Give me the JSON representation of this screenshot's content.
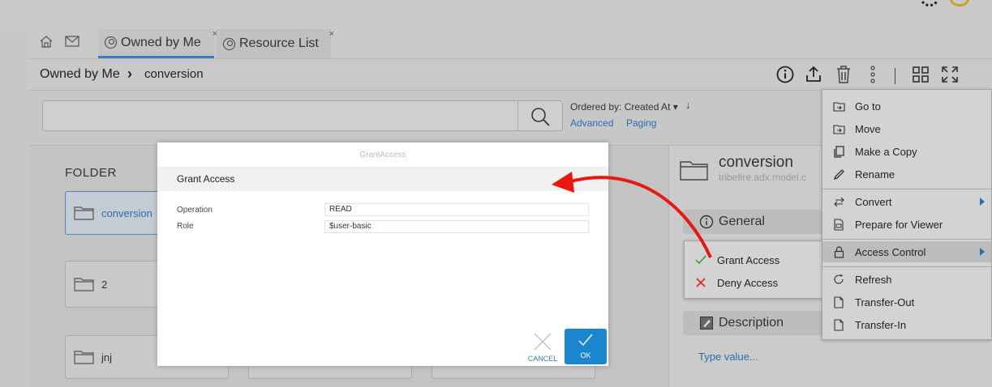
{
  "nav": {
    "tabs": [
      {
        "label": "Owned by Me",
        "close": "×"
      },
      {
        "label": "Resource List",
        "close": "×"
      }
    ]
  },
  "breadcrumb": {
    "root": "Owned by Me",
    "separator": "›",
    "current": "conversion"
  },
  "search": {
    "placeholder": "",
    "ordered_by": "Ordered by: Created At ▾",
    "order_dir": "↓",
    "advanced": "Advanced",
    "paging": "Paging"
  },
  "folders": {
    "title": "FOLDER",
    "items": [
      "conversion",
      "2",
      "jnj"
    ]
  },
  "details": {
    "name": "conversion",
    "subtitle": "tribefire.adx.model.c",
    "general": "General",
    "description": "Description",
    "type_value": "Type value..."
  },
  "dialog": {
    "header": "GrantAccess",
    "title": "Grant Access",
    "fields": [
      {
        "label": "Operation",
        "value": "READ"
      },
      {
        "label": "Role",
        "value": "$user-basic"
      }
    ],
    "cancel": "CANCEL",
    "ok": "OK"
  },
  "context_menu": {
    "items": [
      {
        "label": "Go to",
        "icon": "goto-icon"
      },
      {
        "label": "Move",
        "icon": "move-icon"
      },
      {
        "label": "Make a Copy",
        "icon": "copy-icon"
      },
      {
        "label": "Rename",
        "icon": "pencil-icon"
      },
      {
        "label": "Convert",
        "icon": "convert-icon"
      },
      {
        "label": "Prepare for Viewer",
        "icon": "viewer-icon"
      },
      {
        "label": "Access Control",
        "icon": "lock-icon"
      },
      {
        "label": "Refresh",
        "icon": "refresh-icon"
      },
      {
        "label": "Transfer-Out",
        "icon": "transfer-out-icon"
      },
      {
        "label": "Transfer-In",
        "icon": "transfer-in-icon"
      }
    ]
  },
  "submenu": {
    "items": [
      {
        "label": "Grant Access",
        "icon": "check-icon"
      },
      {
        "label": "Deny Access",
        "icon": "x-icon"
      }
    ]
  },
  "colors": {
    "accent": "#3b7dc4",
    "ok_button": "#1a86d0",
    "arrow": "#e8170f",
    "grant": "#2e9e3c",
    "deny": "#e0231a"
  }
}
